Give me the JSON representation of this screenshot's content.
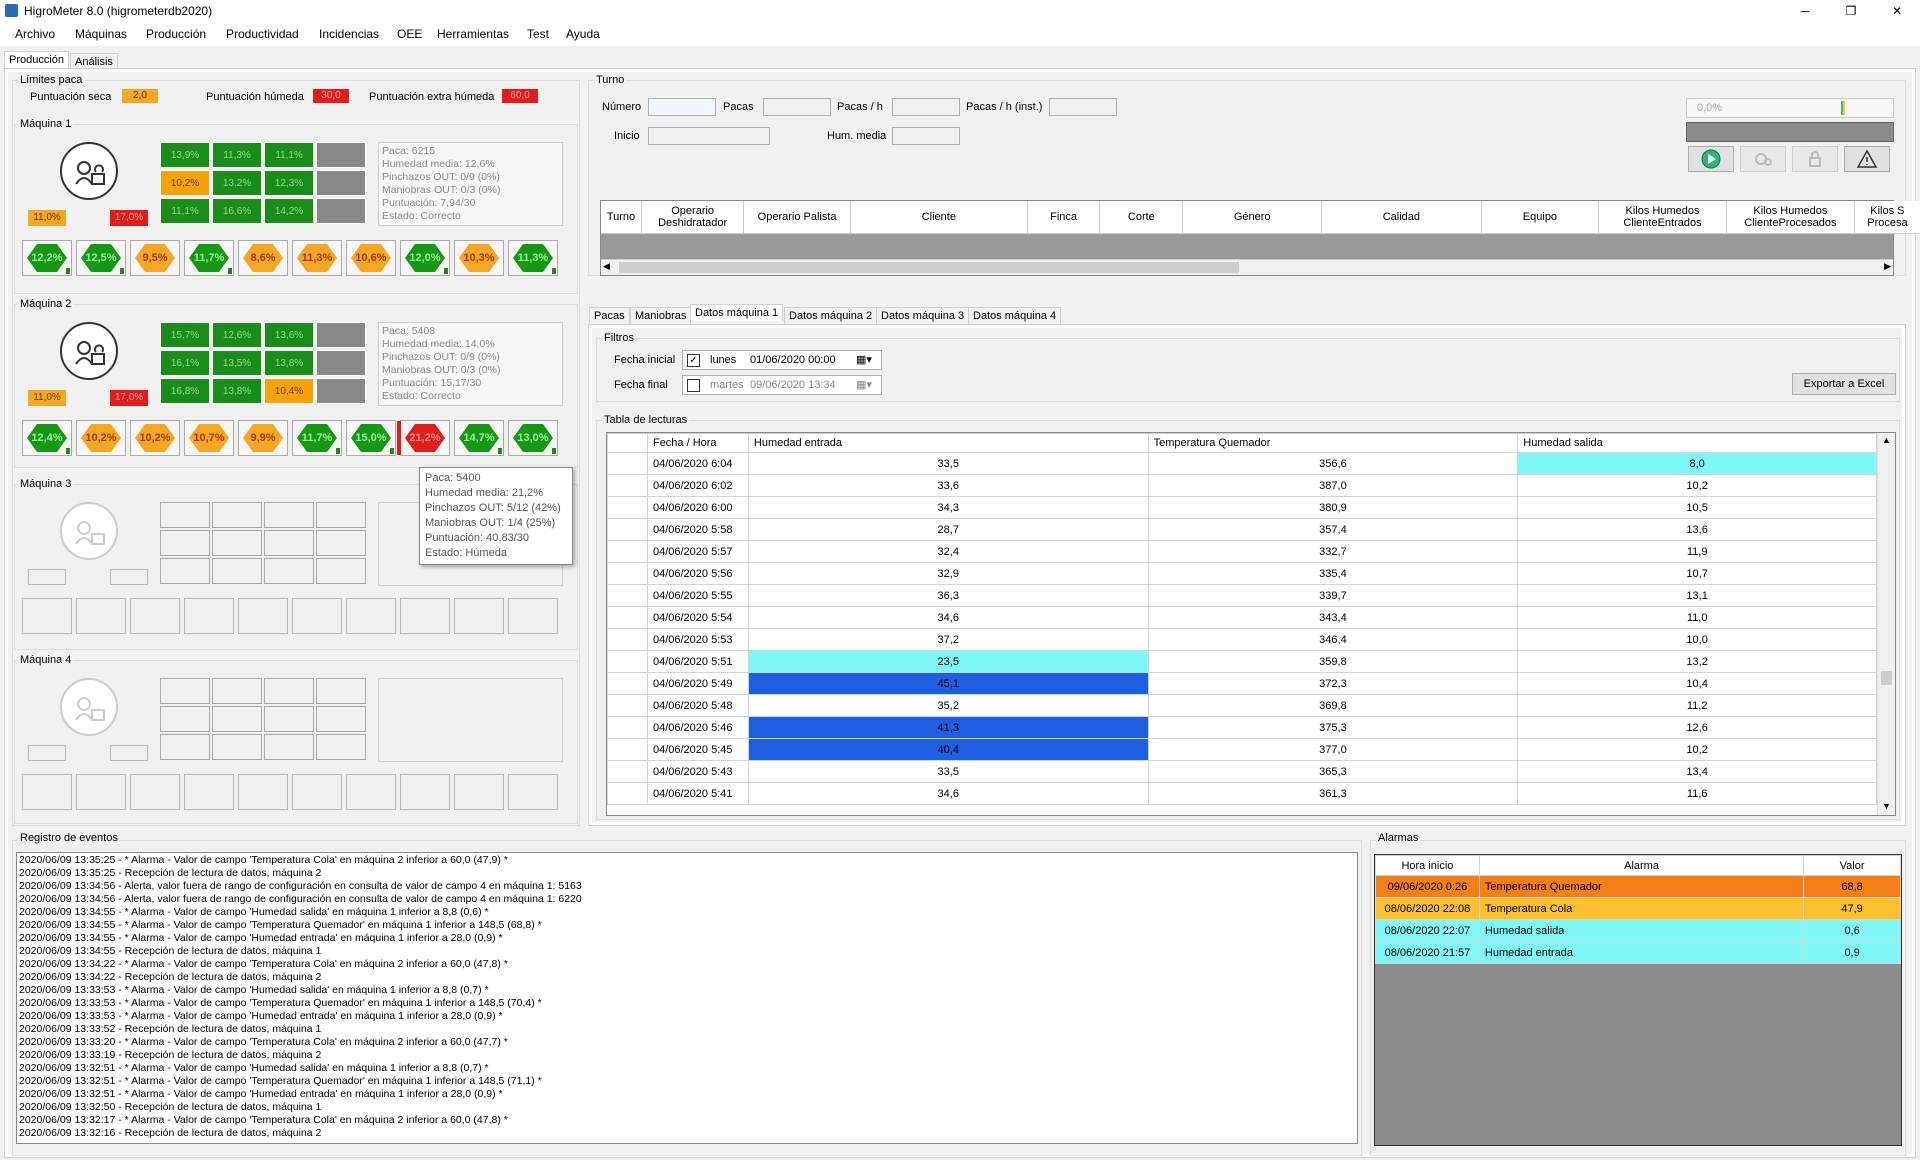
{
  "window": {
    "title": "HigroMeter 8.0 (higrometerdb2020)",
    "minimize": "─",
    "maximize": "❐",
    "close": "✕"
  },
  "menu": [
    "Archivo",
    "Máquinas",
    "Producción",
    "Productividad",
    "Incidencias",
    "OEE",
    "Herramientas",
    "Test",
    "Ayuda"
  ],
  "main_tabs": [
    {
      "label": "Producción",
      "selected": true
    },
    {
      "label": "Análisis",
      "selected": false
    }
  ],
  "limits": {
    "group": "Límites paca",
    "dry_label": "Puntuación seca",
    "dry_value": "2,0",
    "dry_color": "#f5a623",
    "wet_label": "Puntuación húmeda",
    "wet_value": "30,0",
    "wet_color": "#e21b1b",
    "xwet_label": "Puntuación extra húmeda",
    "xwet_value": "60,0",
    "xwet_color": "#e21b1b"
  },
  "machines": [
    {
      "title": "Máquina 1",
      "grid": [
        [
          "g",
          "13,9%"
        ],
        [
          "g",
          "11,3%"
        ],
        [
          "g",
          "11,1%"
        ],
        [
          "x",
          ""
        ],
        [
          "o",
          "10,2%"
        ],
        [
          "g",
          "13,2%"
        ],
        [
          "g",
          "12,3%"
        ],
        [
          "x",
          ""
        ],
        [
          "g",
          "11,1%"
        ],
        [
          "g",
          "16,6%"
        ],
        [
          "g",
          "14,2%"
        ],
        [
          "x",
          ""
        ]
      ],
      "info": [
        "Paca: 6215",
        "Humedad media: 12,6%",
        "Pinchazos OUT: 0/9 (0%)",
        "Maniobras OUT: 0/3 (0%)",
        "Puntuación: 7,94/30",
        "Estado: Correcto"
      ],
      "stat_left": "11,0%",
      "stat_right": "17,0%",
      "bales": [
        [
          "g",
          "12,2%"
        ],
        [
          "g",
          "12,5%"
        ],
        [
          "o",
          "9,5%"
        ],
        [
          "g",
          "11,7%"
        ],
        [
          "o",
          "8,6%"
        ],
        [
          "o",
          "11,3%"
        ],
        [
          "o",
          "10,6%"
        ],
        [
          "g",
          "12,0%"
        ],
        [
          "o",
          "10,3%"
        ],
        [
          "g",
          "11,3%"
        ]
      ]
    },
    {
      "title": "Máquina 2",
      "grid": [
        [
          "g",
          "15,7%"
        ],
        [
          "g",
          "12,6%"
        ],
        [
          "g",
          "13,6%"
        ],
        [
          "x",
          ""
        ],
        [
          "g",
          "16,1%"
        ],
        [
          "g",
          "13,5%"
        ],
        [
          "g",
          "13,8%"
        ],
        [
          "x",
          ""
        ],
        [
          "g",
          "16,8%"
        ],
        [
          "g",
          "13,8%"
        ],
        [
          "o",
          "10,4%"
        ],
        [
          "x",
          ""
        ]
      ],
      "info": [
        "Paca: 5408",
        "Humedad media: 14,0%",
        "Pinchazos OUT: 0/9 (0%)",
        "Maniobras OUT: 0/3 (0%)",
        "Puntuación: 15,17/30",
        "Estado: Correcto"
      ],
      "stat_left": "11,0%",
      "stat_right": "17,0%",
      "bales": [
        [
          "g",
          "12,4%"
        ],
        [
          "o",
          "10,2%"
        ],
        [
          "o",
          "10,2%"
        ],
        [
          "o",
          "10,7%"
        ],
        [
          "o",
          "9,9%"
        ],
        [
          "g",
          "11,7%"
        ],
        [
          "g",
          "15,0%"
        ],
        [
          "r",
          "21,2%"
        ],
        [
          "g",
          "14,7%"
        ],
        [
          "g",
          "13,0%"
        ]
      ]
    },
    {
      "title": "Máquina 3"
    },
    {
      "title": "Máquina 4"
    }
  ],
  "tooltip": [
    "Paca: 5400",
    "Humedad media: 21,2%",
    "Pinchazos OUT: 5/12 (42%)",
    "Maniobras OUT: 1/4 (25%)",
    "Puntuación: 40,83/30",
    "Estado: Húmeda"
  ],
  "turno": {
    "group": "Turno",
    "numero": "Número",
    "pacas": "Pacas",
    "pacas_h": "Pacas / h",
    "pacas_h_inst": "Pacas / h (inst.)",
    "inicio": "Inicio",
    "hum_media": "Hum. media",
    "progress": "0,0%",
    "columns": [
      "Turno",
      "Operario Deshidratador",
      "Operario Palista",
      "Cliente",
      "Finca",
      "Corte",
      "Género",
      "Calidad",
      "Equipo",
      "Kilos Humedos ClienteEntrados",
      "Kilos Humedos ClienteProcesados",
      "Kilos S Procesa"
    ]
  },
  "data_tabs": [
    {
      "label": "Pacas",
      "selected": false
    },
    {
      "label": "Maniobras",
      "selected": false
    },
    {
      "label": "Datos máquina 1",
      "selected": true
    },
    {
      "label": "Datos máquina 2",
      "selected": false
    },
    {
      "label": "Datos máquina 3",
      "selected": false
    },
    {
      "label": "Datos máquina 4",
      "selected": false
    }
  ],
  "filters": {
    "group": "Filtros",
    "start_label": "Fecha inicial",
    "start_checked": true,
    "start_day": "lunes",
    "start_value": "01/06/2020 00:00",
    "end_label": "Fecha final",
    "end_checked": false,
    "end_day": "martes",
    "end_value": "09/06/2020 13:34",
    "export": "Exportar a Excel"
  },
  "readings": {
    "group": "Tabla de lecturas",
    "columns": [
      "Fecha / Hora",
      "Humedad entrada",
      "Temperatura Quemador",
      "Humedad salida"
    ],
    "rows": [
      [
        "04/06/2020 6:04",
        "33,5",
        "356,6",
        "8,0",
        "",
        "",
        "cyan"
      ],
      [
        "04/06/2020 6:02",
        "33,6",
        "387,0",
        "10,2",
        "",
        "",
        ""
      ],
      [
        "04/06/2020 6:00",
        "34,3",
        "380,9",
        "10,5",
        "",
        "",
        ""
      ],
      [
        "04/06/2020 5:58",
        "28,7",
        "357,4",
        "13,6",
        "",
        "",
        ""
      ],
      [
        "04/06/2020 5:57",
        "32,4",
        "332,7",
        "11,9",
        "",
        "",
        ""
      ],
      [
        "04/06/2020 5:56",
        "32,9",
        "335,4",
        "10,7",
        "",
        "",
        ""
      ],
      [
        "04/06/2020 5:55",
        "36,3",
        "339,7",
        "13,1",
        "",
        "",
        ""
      ],
      [
        "04/06/2020 5:54",
        "34,6",
        "343,4",
        "11,0",
        "",
        "",
        ""
      ],
      [
        "04/06/2020 5:53",
        "37,2",
        "346,4",
        "10,0",
        "",
        "",
        ""
      ],
      [
        "04/06/2020 5:51",
        "23,5",
        "359,8",
        "13,2",
        "cyan",
        "",
        ""
      ],
      [
        "04/06/2020 5:49",
        "45,1",
        "372,3",
        "10,4",
        "blue",
        "",
        ""
      ],
      [
        "04/06/2020 5:48",
        "35,2",
        "369,8",
        "11,2",
        "",
        "",
        ""
      ],
      [
        "04/06/2020 5:46",
        "41,3",
        "375,3",
        "12,6",
        "blue",
        "",
        ""
      ],
      [
        "04/06/2020 5:45",
        "40,4",
        "377,0",
        "10,2",
        "blue",
        "",
        ""
      ],
      [
        "04/06/2020 5:43",
        "33,5",
        "365,3",
        "13,4",
        "",
        "",
        ""
      ],
      [
        "04/06/2020 5:41",
        "34,6",
        "361,3",
        "11,6",
        "",
        "",
        ""
      ]
    ]
  },
  "events": {
    "group": "Registro de eventos",
    "lines": [
      "2020/06/09 13:35:25 - * Alarma - Valor de campo 'Temperatura Cola' en máquina 2 inferior a 60,0 (47,9) *",
      "2020/06/09 13:35:25 - Recepción de lectura de datos, máquina 2",
      "2020/06/09 13:34:56 - Alerta, valor fuera de rango de configuración en consulta de valor de campo 4 en máquina 1: 5163",
      "2020/06/09 13:34:56 - Alerta, valor fuera de rango de configuración en consulta de valor de campo 4 en máquina 1: 6220",
      "2020/06/09 13:34:55 - * Alarma - Valor de campo 'Humedad salida' en máquina 1 inferior a 8,8 (0,6) *",
      "2020/06/09 13:34:55 - * Alarma - Valor de campo 'Temperatura Quemador' en máquina 1 inferior a 148,5 (68,8) *",
      "2020/06/09 13:34:55 - * Alarma - Valor de campo 'Humedad entrada' en máquina 1 inferior a 28,0 (0,9) *",
      "2020/06/09 13:34:55 - Recepción de lectura de datos, máquina 1",
      "2020/06/09 13:34:22 - * Alarma - Valor de campo 'Temperatura Cola' en máquina 2 inferior a 60,0 (47,8) *",
      "2020/06/09 13:34:22 - Recepción de lectura de datos, máquina 2",
      "2020/06/09 13:33:53 - * Alarma - Valor de campo 'Humedad salida' en máquina 1 inferior a 8,8 (0,7) *",
      "2020/06/09 13:33:53 - * Alarma - Valor de campo 'Temperatura Quemador' en máquina 1 inferior a 148,5 (70,4) *",
      "2020/06/09 13:33:53 - * Alarma - Valor de campo 'Humedad entrada' en máquina 1 inferior a 28,0 (0,9) *",
      "2020/06/09 13:33:52 - Recepción de lectura de datos, máquina 1",
      "2020/06/09 13:33:20 - * Alarma - Valor de campo 'Temperatura Cola' en máquina 2 inferior a 60,0 (47,7) *",
      "2020/06/09 13:33:19 - Recepción de lectura de datos, máquina 2",
      "2020/06/09 13:32:51 - * Alarma - Valor de campo 'Humedad salida' en máquina 1 inferior a 8,8 (0,7) *",
      "2020/06/09 13:32:51 - * Alarma - Valor de campo 'Temperatura Quemador' en máquina 1 inferior a 148,5 (71,1) *",
      "2020/06/09 13:32:51 - * Alarma - Valor de campo 'Humedad entrada' en máquina 1 inferior a 28,0 (0,9) *",
      "2020/06/09 13:32:50 - Recepción de lectura de datos, máquina 1",
      "2020/06/09 13:32:17 - * Alarma - Valor de campo 'Temperatura Cola' en máquina 2 inferior a 60,0 (47,8) *",
      "2020/06/09 13:32:16 - Recepción de lectura de datos, máquina 2"
    ]
  },
  "alarms": {
    "group": "Alarmas",
    "columns": [
      "Hora inicio",
      "Alarma",
      "Valor"
    ],
    "rows": [
      [
        "09/06/2020 0:26",
        "Temperatura Quemador",
        "68,8",
        "#f57f17"
      ],
      [
        "08/06/2020 22:08",
        "Temperatura Cola",
        "47,9",
        "#fbc02d"
      ],
      [
        "08/06/2020 22:07",
        "Humedad salida",
        "0,6",
        "#7ff7f7"
      ],
      [
        "08/06/2020 21:57",
        "Humedad entrada",
        "0,9",
        "#7ff7f7"
      ]
    ]
  }
}
